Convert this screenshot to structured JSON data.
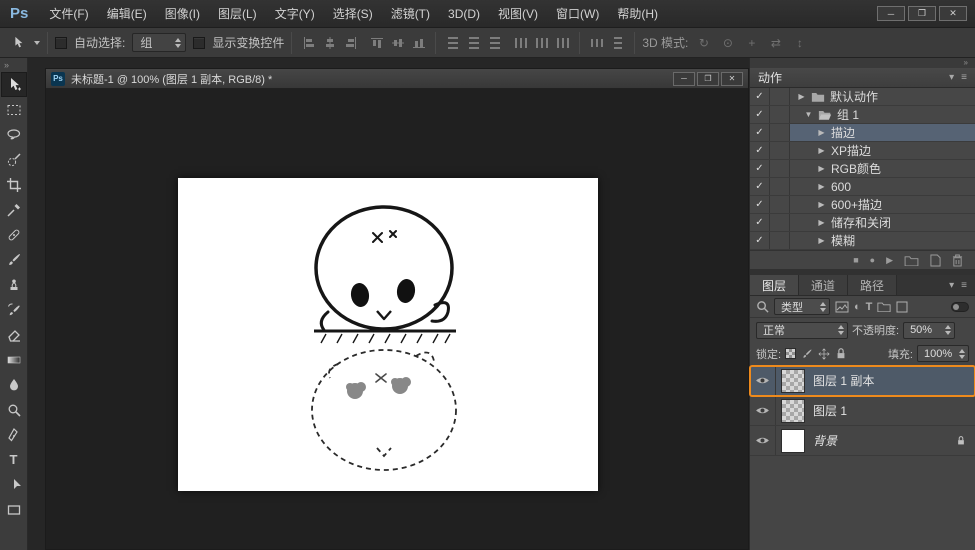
{
  "icons": {
    "check": "✓",
    "collapsed": "▶",
    "expanded": "▼",
    "minimize": "─",
    "maximize": "❐",
    "close": "✕",
    "panel_arrow": "▾",
    "panel_menu": "≡",
    "chevrons": "»",
    "stop": "■",
    "record": "●",
    "play": "▶",
    "adjustment": "◐",
    "type": "T"
  },
  "app": {
    "logo": "Ps",
    "menus": [
      "文件(F)",
      "编辑(E)",
      "图像(I)",
      "图层(L)",
      "文字(Y)",
      "选择(S)",
      "滤镜(T)",
      "3D(D)",
      "视图(V)",
      "窗口(W)",
      "帮助(H)"
    ]
  },
  "options_bar": {
    "auto_select_label": "自动选择:",
    "auto_select_value": "组",
    "show_transform_label": "显示变换控件",
    "mode_3d_label": "3D 模式:",
    "icons3d": [
      "↻",
      "⊙",
      "+",
      "⇄",
      "↕"
    ]
  },
  "document": {
    "title": "未标题-1 @ 100% (图层 1 副本, RGB/8) *"
  },
  "actions_panel": {
    "title": "动作",
    "items": [
      {
        "label": "默认动作"
      },
      {
        "label": "组 1"
      },
      {
        "label": "描边"
      },
      {
        "label": "XP描边"
      },
      {
        "label": "RGB颜色"
      },
      {
        "label": "600"
      },
      {
        "label": "600+描边"
      },
      {
        "label": "储存和关闭"
      },
      {
        "label": "模糊"
      }
    ]
  },
  "layers_panel": {
    "tabs": [
      "图层",
      "通道",
      "路径"
    ],
    "filter_label": "类型",
    "blend_mode": "正常",
    "opacity_label": "不透明度:",
    "opacity_value": "50%",
    "lock_label": "锁定:",
    "fill_label": "填充:",
    "fill_value": "100%",
    "layers": [
      {
        "name": "图层 1 副本"
      },
      {
        "name": "图层 1"
      },
      {
        "name": "背景"
      }
    ]
  },
  "colors": {
    "selection_orange": "#ee8a1c",
    "selected_row": "#566374",
    "accent_blue": "#8ab9e0"
  }
}
